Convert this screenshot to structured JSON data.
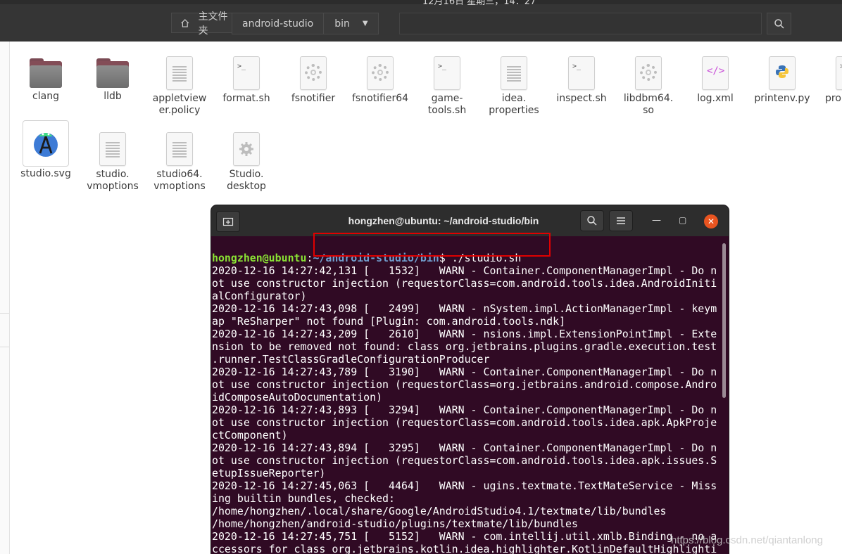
{
  "system": {
    "clock": "12月16日 星期三，14：27"
  },
  "pathbar": {
    "segments": [
      "主文件夹",
      "android-studio",
      "bin"
    ]
  },
  "files": [
    {
      "name": "clang",
      "kind": "folder"
    },
    {
      "name": "lldb",
      "kind": "folder"
    },
    {
      "name": "appletviewer.policy",
      "kind": "text"
    },
    {
      "name": "format.sh",
      "kind": "script"
    },
    {
      "name": "fsnotifier",
      "kind": "binary"
    },
    {
      "name": "fsnotifier64",
      "kind": "binary"
    },
    {
      "name": "game-tools.sh",
      "kind": "script"
    },
    {
      "name": "idea.properties",
      "kind": "text"
    },
    {
      "name": "inspect.sh",
      "kind": "script"
    },
    {
      "name": "libdbm64.so",
      "kind": "binary"
    },
    {
      "name": "log.xml",
      "kind": "xml"
    },
    {
      "name": "printenv.py",
      "kind": "python"
    },
    {
      "name": "pro",
      "kind": "script"
    },
    {
      "name": "studio.svg",
      "kind": "image"
    },
    {
      "name": "studio.vmoptions",
      "kind": "text"
    },
    {
      "name": "studio64.vmoptions",
      "kind": "text"
    },
    {
      "name": "Studio.desktop",
      "kind": "desktop"
    }
  ],
  "labels": {
    "clang": "clang",
    "lldb": "lldb",
    "appletviewer_1": "appletview",
    "appletviewer_2": "er.policy",
    "format": "format.sh",
    "fsnotifier": "fsnotifier",
    "fsnotifier64": "fsnotifier64",
    "game_1": "game-",
    "game_2": "tools.sh",
    "idea_1": "idea.",
    "idea_2": "properties",
    "inspect": "inspect.sh",
    "libdbm_1": "libdbm64.",
    "libdbm_2": "so",
    "logxml": "log.xml",
    "printenv": "printenv.py",
    "pro": "pro",
    "studiosvg": "studio.svg",
    "studiovm_1": "studio.",
    "studiovm_2": "vmoptions",
    "studio64_1": "studio64.",
    "studio64_2": "vmoptions",
    "desktop_1": "Studio.",
    "desktop_2": "desktop"
  },
  "terminal": {
    "title": "hongzhen@ubuntu: ~/android-studio/bin",
    "prompt_user": "hongzhen@ubuntu",
    "prompt_sep": ":",
    "prompt_path": "~/android-studio/bin",
    "prompt_cmd": "$ ./studio.sh",
    "lines": [
      "2020-12-16 14:27:42,131 [   1532]   WARN - Container.ComponentManagerImpl - Do n",
      "ot use constructor injection (requestorClass=com.android.tools.idea.AndroidIniti",
      "alConfigurator)",
      "2020-12-16 14:27:43,098 [   2499]   WARN - nSystem.impl.ActionManagerImpl - keym",
      "ap \"ReSharper\" not found [Plugin: com.android.tools.ndk]",
      "2020-12-16 14:27:43,209 [   2610]   WARN - nsions.impl.ExtensionPointImpl - Exte",
      "nsion to be removed not found: class org.jetbrains.plugins.gradle.execution.test",
      ".runner.TestClassGradleConfigurationProducer",
      "2020-12-16 14:27:43,789 [   3190]   WARN - Container.ComponentManagerImpl - Do n",
      "ot use constructor injection (requestorClass=org.jetbrains.android.compose.Andro",
      "idComposeAutoDocumentation)",
      "2020-12-16 14:27:43,893 [   3294]   WARN - Container.ComponentManagerImpl - Do n",
      "ot use constructor injection (requestorClass=com.android.tools.idea.apk.ApkProje",
      "ctComponent)",
      "2020-12-16 14:27:43,894 [   3295]   WARN - Container.ComponentManagerImpl - Do n",
      "ot use constructor injection (requestorClass=com.android.tools.idea.apk.issues.S",
      "etupIssueReporter)",
      "2020-12-16 14:27:45,063 [   4464]   WARN - ugins.textmate.TextMateService - Miss",
      "ing builtin bundles, checked:",
      "/home/hongzhen/.local/share/Google/AndroidStudio4.1/textmate/lib/bundles",
      "/home/hongzhen/android-studio/plugins/textmate/lib/bundles",
      "2020-12-16 14:27:45,751 [   5152]   WARN - com.intellij.util.xmlb.Binding - no a",
      "ccessors for class org.jetbrains.kotlin.idea.highlighter.KotlinDefaultHighlighti"
    ]
  },
  "watermark": "https://blog.csdn.net/qiantanlong",
  "colors": {
    "terminal_bg": "#300a24",
    "prompt_user": "#8ae234",
    "prompt_path": "#729fcf",
    "close_button": "#e95420",
    "highlight_box": "#e00000"
  }
}
